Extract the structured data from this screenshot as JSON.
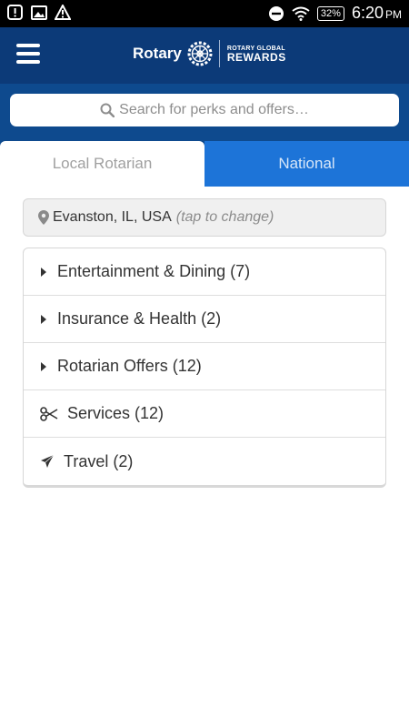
{
  "status_bar": {
    "time": "6:20",
    "ampm": "PM",
    "battery": "32%"
  },
  "header": {
    "brand_name": "Rotary",
    "brand_subtitle": "ROTARY GLOBAL",
    "brand_title": "REWARDS"
  },
  "search": {
    "placeholder": "Search for perks and offers…"
  },
  "tabs": [
    {
      "label": "Local Rotarian",
      "active": true
    },
    {
      "label": "National",
      "active": false
    }
  ],
  "location": {
    "city": "Evanston, IL, USA",
    "hint": "(tap to change)"
  },
  "categories": [
    {
      "label": "Entertainment & Dining (7)",
      "icon": "caret-right-icon"
    },
    {
      "label": "Insurance & Health (2)",
      "icon": "caret-right-icon"
    },
    {
      "label": "Rotarian Offers (12)",
      "icon": "caret-right-icon"
    },
    {
      "label": "Services (12)",
      "icon": "scissors-icon"
    },
    {
      "label": "Travel (2)",
      "icon": "airplane-icon"
    }
  ],
  "colors": {
    "header_bg": "#0c3a78",
    "search_bg": "#0e4a8e",
    "tab_inactive_bg": "#1d74d8"
  }
}
